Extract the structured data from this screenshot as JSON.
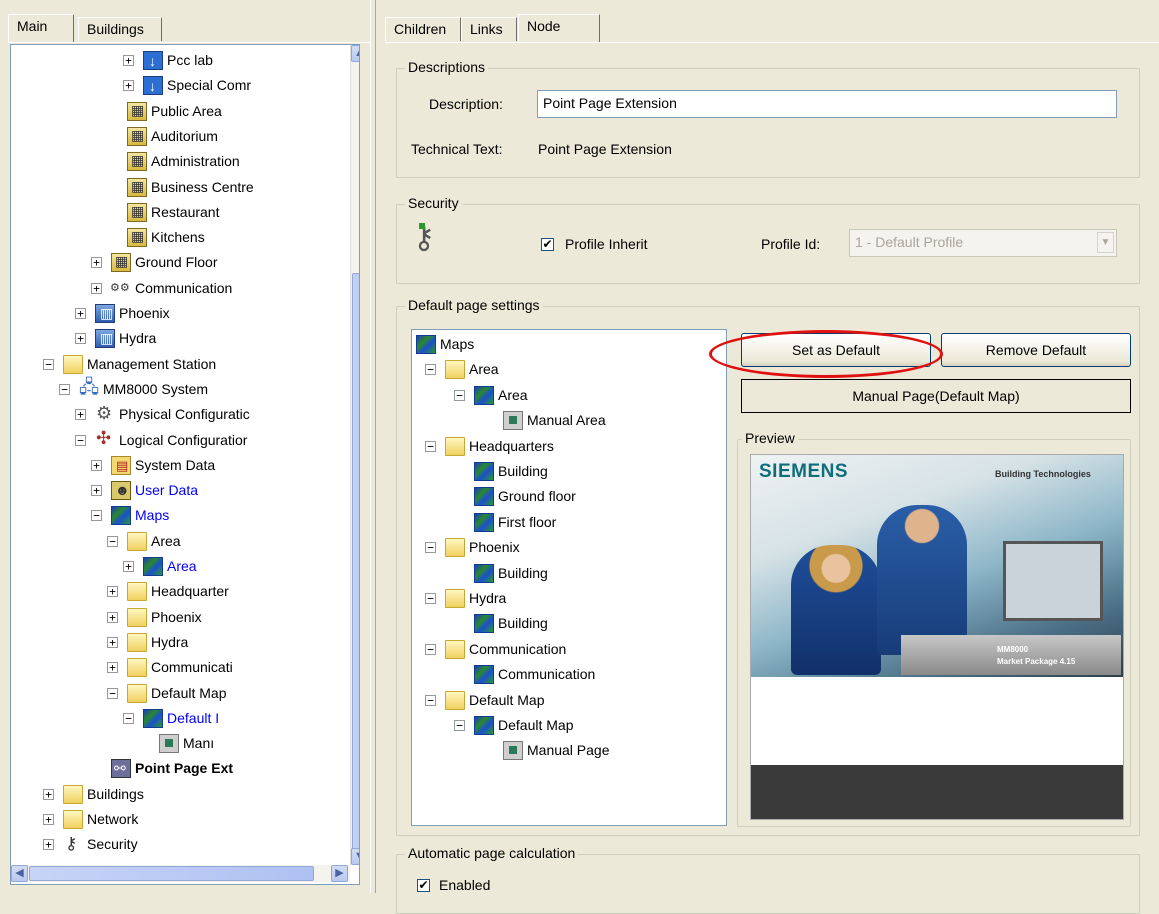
{
  "left_tabs": [
    "Main",
    "Buildings"
  ],
  "right_tabs": [
    "Children",
    "Links",
    "Node"
  ],
  "left_tree": [
    {
      "label": "Pcc lab",
      "icon": "pcc-icon",
      "level": 6,
      "pm": "+",
      "style": ""
    },
    {
      "label": "Special Comr",
      "icon": "pcc-icon",
      "level": 6,
      "pm": "+",
      "style": ""
    },
    {
      "label": "Public Area",
      "icon": "building-icon",
      "level": 5,
      "pm": "",
      "style": ""
    },
    {
      "label": "Auditorium",
      "icon": "building-icon",
      "level": 5,
      "pm": "",
      "style": ""
    },
    {
      "label": "Administration",
      "icon": "building-icon",
      "level": 5,
      "pm": "",
      "style": ""
    },
    {
      "label": "Business Centre",
      "icon": "building-icon",
      "level": 5,
      "pm": "",
      "style": ""
    },
    {
      "label": "Restaurant",
      "icon": "building-icon",
      "level": 5,
      "pm": "",
      "style": ""
    },
    {
      "label": "Kitchens",
      "icon": "building-icon",
      "level": 5,
      "pm": "",
      "style": ""
    },
    {
      "label": "Ground  Floor",
      "icon": "building-icon",
      "level": 4,
      "pm": "+",
      "style": ""
    },
    {
      "label": "Communication",
      "icon": "comm-icon",
      "level": 4,
      "pm": "+",
      "style": ""
    },
    {
      "label": "Phoenix",
      "icon": "city-icon",
      "level": 3,
      "pm": "+",
      "style": ""
    },
    {
      "label": "Hydra",
      "icon": "city-icon",
      "level": 3,
      "pm": "+",
      "style": ""
    },
    {
      "label": "Management Station",
      "icon": "folder-icon",
      "level": 1,
      "pm": "−",
      "style": ""
    },
    {
      "label": "MM8000 System",
      "icon": "system-icon",
      "level": 2,
      "pm": "−",
      "style": ""
    },
    {
      "label": "Physical Configuratic",
      "icon": "gear-icon",
      "level": 3,
      "pm": "+",
      "style": ""
    },
    {
      "label": "Logical Configuratior",
      "icon": "logic-icon",
      "level": 3,
      "pm": "−",
      "style": ""
    },
    {
      "label": "System Data",
      "icon": "system-data-icon",
      "level": 4,
      "pm": "+",
      "style": ""
    },
    {
      "label": "User Data",
      "icon": "user-data-icon",
      "level": 4,
      "pm": "+",
      "style": "blue"
    },
    {
      "label": "Maps",
      "icon": "map-icon",
      "level": 4,
      "pm": "−",
      "style": "blue"
    },
    {
      "label": "Area",
      "icon": "folder-icon",
      "level": 5,
      "pm": "−",
      "style": ""
    },
    {
      "label": "Area",
      "icon": "map-icon",
      "level": 6,
      "pm": "+",
      "style": "blue"
    },
    {
      "label": "Headquarter",
      "icon": "folder-icon",
      "level": 5,
      "pm": "+",
      "style": ""
    },
    {
      "label": "Phoenix",
      "icon": "folder-icon",
      "level": 5,
      "pm": "+",
      "style": ""
    },
    {
      "label": "Hydra",
      "icon": "folder-icon",
      "level": 5,
      "pm": "+",
      "style": ""
    },
    {
      "label": "Communicati",
      "icon": "folder-icon",
      "level": 5,
      "pm": "+",
      "style": ""
    },
    {
      "label": "Default Map",
      "icon": "folder-icon",
      "level": 5,
      "pm": "−",
      "style": ""
    },
    {
      "label": "Default I",
      "icon": "map-icon",
      "level": 6,
      "pm": "−",
      "style": "blue"
    },
    {
      "label": "Manı",
      "icon": "node-icon",
      "level": 7,
      "pm": "",
      "style": ""
    },
    {
      "label": "Point Page Ext",
      "icon": "point-page-icon",
      "level": 4,
      "pm": "",
      "style": "bold"
    },
    {
      "label": "Buildings",
      "icon": "folder-icon",
      "level": 1,
      "pm": "+",
      "style": ""
    },
    {
      "label": "Network",
      "icon": "folder-icon",
      "level": 1,
      "pm": "+",
      "style": ""
    },
    {
      "label": "Security",
      "icon": "security-icon",
      "level": 1,
      "pm": "+",
      "style": ""
    }
  ],
  "descriptions": {
    "title": "Descriptions",
    "description_label": "Description:",
    "description_value": "Point Page Extension",
    "technical_label": "Technical Text:",
    "technical_value": "Point Page Extension"
  },
  "security": {
    "title": "Security",
    "profile_inherit_label": "Profile Inherit",
    "profile_inherit_checked": "✔",
    "profile_id_label": "Profile Id:",
    "profile_id_value": "1 - Default Profile"
  },
  "default_page": {
    "title": "Default page settings",
    "set_default_label": "Set as Default",
    "remove_default_label": "Remove Default",
    "manual_page_label": "Manual Page(Default Map)",
    "preview_title": "Preview",
    "preview_brand": "SIEMENS",
    "preview_tagline": "Building Technologies",
    "preview_product": "MM8000",
    "preview_package": "Market Package 4.15",
    "tree": [
      {
        "label": "Maps",
        "icon": "map-icon",
        "level": 0,
        "pm": ""
      },
      {
        "label": "Area",
        "icon": "folder-icon",
        "level": 1,
        "pm": "−"
      },
      {
        "label": "Area",
        "icon": "map-icon",
        "level": 2,
        "pm": "−"
      },
      {
        "label": "Manual Area",
        "icon": "node-icon",
        "level": 3,
        "pm": ""
      },
      {
        "label": "Headquarters",
        "icon": "folder-icon",
        "level": 1,
        "pm": "−"
      },
      {
        "label": "Building",
        "icon": "map-icon",
        "level": 2,
        "pm": ""
      },
      {
        "label": "Ground floor",
        "icon": "map-icon",
        "level": 2,
        "pm": ""
      },
      {
        "label": "First floor",
        "icon": "map-icon",
        "level": 2,
        "pm": ""
      },
      {
        "label": "Phoenix",
        "icon": "folder-icon",
        "level": 1,
        "pm": "−"
      },
      {
        "label": "Building",
        "icon": "map-icon",
        "level": 2,
        "pm": ""
      },
      {
        "label": "Hydra",
        "icon": "folder-icon",
        "level": 1,
        "pm": "−"
      },
      {
        "label": "Building",
        "icon": "map-icon",
        "level": 2,
        "pm": ""
      },
      {
        "label": "Communication",
        "icon": "folder-icon",
        "level": 1,
        "pm": "−"
      },
      {
        "label": "Communication",
        "icon": "map-icon",
        "level": 2,
        "pm": ""
      },
      {
        "label": "Default Map",
        "icon": "folder-icon",
        "level": 1,
        "pm": "−"
      },
      {
        "label": "Default Map",
        "icon": "map-icon",
        "level": 2,
        "pm": "−"
      },
      {
        "label": "Manual Page",
        "icon": "node-icon",
        "level": 3,
        "pm": ""
      }
    ]
  },
  "auto_calc": {
    "title": "Automatic page calculation",
    "enabled_label": "Enabled",
    "enabled_checked": "✔"
  },
  "colors": {
    "highlight_ellipse": "#e01010",
    "link_blue": "#0000ff"
  }
}
